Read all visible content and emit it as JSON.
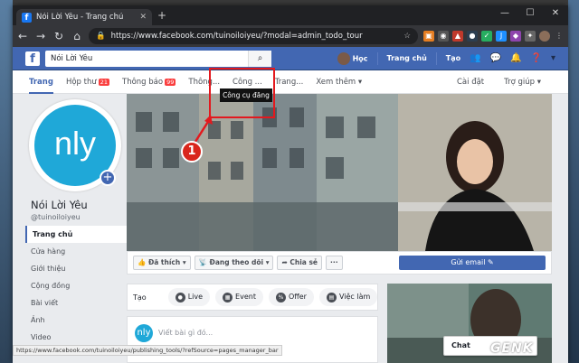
{
  "browser": {
    "tab_title": "Nói Lời Yêu - Trang chủ",
    "favicon": "f",
    "url": "https://www.facebook.com/tuinoiloiyeu/?modal=admin_todo_tour",
    "status_url": "https://www.facebook.com/tuinoiloiyeu/publishing_tools/?refSource=pages_manager_bar"
  },
  "fb_header": {
    "logo": "f",
    "search_value": "Nói Lời Yêu",
    "user_name": "Học",
    "home": "Trang chủ",
    "create": "Tạo"
  },
  "page_tabs": {
    "main": [
      "Trang",
      "Hộp thư",
      "Thông báo",
      "Thông...",
      "Công ...",
      "Trang...",
      "Xem thêm"
    ],
    "inbox_badge": "21",
    "notif_badge": "99",
    "settings": "Cài đặt",
    "help": "Trợ giúp"
  },
  "annotation": {
    "tooltip": "Công cụ đăng",
    "step_number": "1"
  },
  "profile": {
    "initials": "nly",
    "name": "Nói Lời Yêu",
    "handle": "@tuinoiloiyeu",
    "menu": [
      "Trang chủ",
      "Cửa hàng",
      "Giới thiệu",
      "Cộng đồng",
      "Bài viết",
      "Ảnh",
      "Video"
    ]
  },
  "actions": {
    "liked": "Đã thích",
    "following": "Đang theo dõi",
    "share": "Chia sẻ",
    "more": "···",
    "send_email": "Gửi email"
  },
  "create": {
    "label": "Tạo",
    "buttons": [
      "Live",
      "Event",
      "Offer",
      "Việc làm"
    ]
  },
  "composer": {
    "avatar": "nly",
    "placeholder": "Viết bài gì đó..."
  },
  "chat": "Chat",
  "watermark": "GENK"
}
